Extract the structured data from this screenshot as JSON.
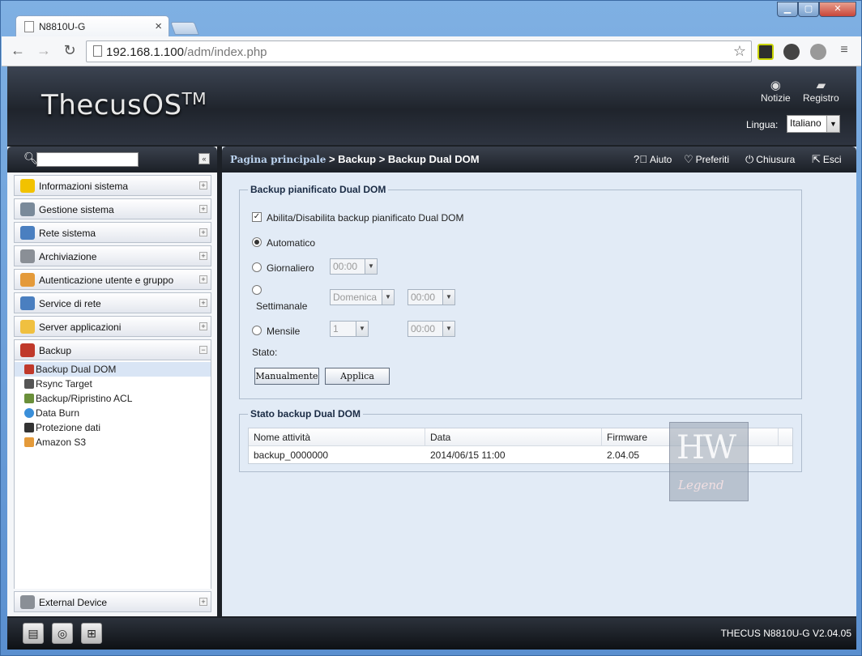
{
  "browser": {
    "tab_title": "N8810U-G",
    "url_host": "192.168.1.100",
    "url_path": "/adm/index.php"
  },
  "header": {
    "logo": "ThecusOS",
    "logo_tm": "TM",
    "news_label": "Notizie",
    "log_label": "Registro",
    "language_label": "Lingua:",
    "language_value": "Italiano"
  },
  "sidebar": {
    "search_value": "",
    "items": [
      {
        "label": "Informazioni sistema",
        "icon": "info-icon",
        "color": "#f2c200"
      },
      {
        "label": "Gestione sistema",
        "icon": "tools-icon",
        "color": "#7a8a9a"
      },
      {
        "label": "Rete sistema",
        "icon": "network-icon",
        "color": "#4a7fc0"
      },
      {
        "label": "Archiviazione",
        "icon": "storage-icon",
        "color": "#8a8f96"
      },
      {
        "label": "Autenticazione utente e gruppo",
        "icon": "users-icon",
        "color": "#e49a3a"
      },
      {
        "label": "Service di rete",
        "icon": "network-service-icon",
        "color": "#4a7fc0"
      },
      {
        "label": "Server applicazioni",
        "icon": "app-server-icon",
        "color": "#f0c040"
      },
      {
        "label": "Backup",
        "icon": "backup-icon",
        "color": "#c0392b"
      }
    ],
    "backup_sub": [
      {
        "label": "Backup Dual DOM",
        "icon": "dual-dom-icon",
        "color": "#c0392b"
      },
      {
        "label": "Rsync Target",
        "icon": "rsync-icon",
        "color": "#555555"
      },
      {
        "label": "Backup/Ripristino ACL",
        "icon": "acl-icon",
        "color": "#6a8f3a"
      },
      {
        "label": "Data Burn",
        "icon": "disc-icon",
        "color": "#3a8fd9"
      },
      {
        "label": "Protezione dati",
        "icon": "data-protection-icon",
        "color": "#333333"
      },
      {
        "label": "Amazon S3",
        "icon": "amazon-s3-icon",
        "color": "#e49a3a"
      }
    ],
    "bottom_item": {
      "label": "External Device",
      "icon": "external-device-icon",
      "color": "#8a8f96"
    }
  },
  "topbar": {
    "crumb_home": "Pagina principale",
    "crumb_rest": " > Backup > Backup Dual DOM",
    "help": "Aiuto",
    "favorites": "Preferiti",
    "shutdown": "Chiusura",
    "logout": "Esci"
  },
  "schedule": {
    "legend": "Backup pianificato Dual DOM",
    "enable_label": "Abilita/Disabilita backup pianificato Dual DOM",
    "automatic": "Automatico",
    "daily": "Giornaliero",
    "weekly": "Settimanale",
    "monthly": "Mensile",
    "daily_time": "00:00",
    "weekly_day": "Domenica",
    "weekly_time": "00:00",
    "monthly_day": "1",
    "monthly_time": "00:00",
    "status_label": "Stato:",
    "manual_button": "Manualmente",
    "apply_button": "Applica"
  },
  "status": {
    "legend": "Stato backup Dual DOM",
    "columns": [
      "Nome attività",
      "Data",
      "Firmware"
    ],
    "rows": [
      [
        "backup_0000000",
        "2014/06/15 11:00",
        "2.04.05"
      ]
    ]
  },
  "footer": {
    "version": "THECUS N8810U-G V2.04.05"
  }
}
